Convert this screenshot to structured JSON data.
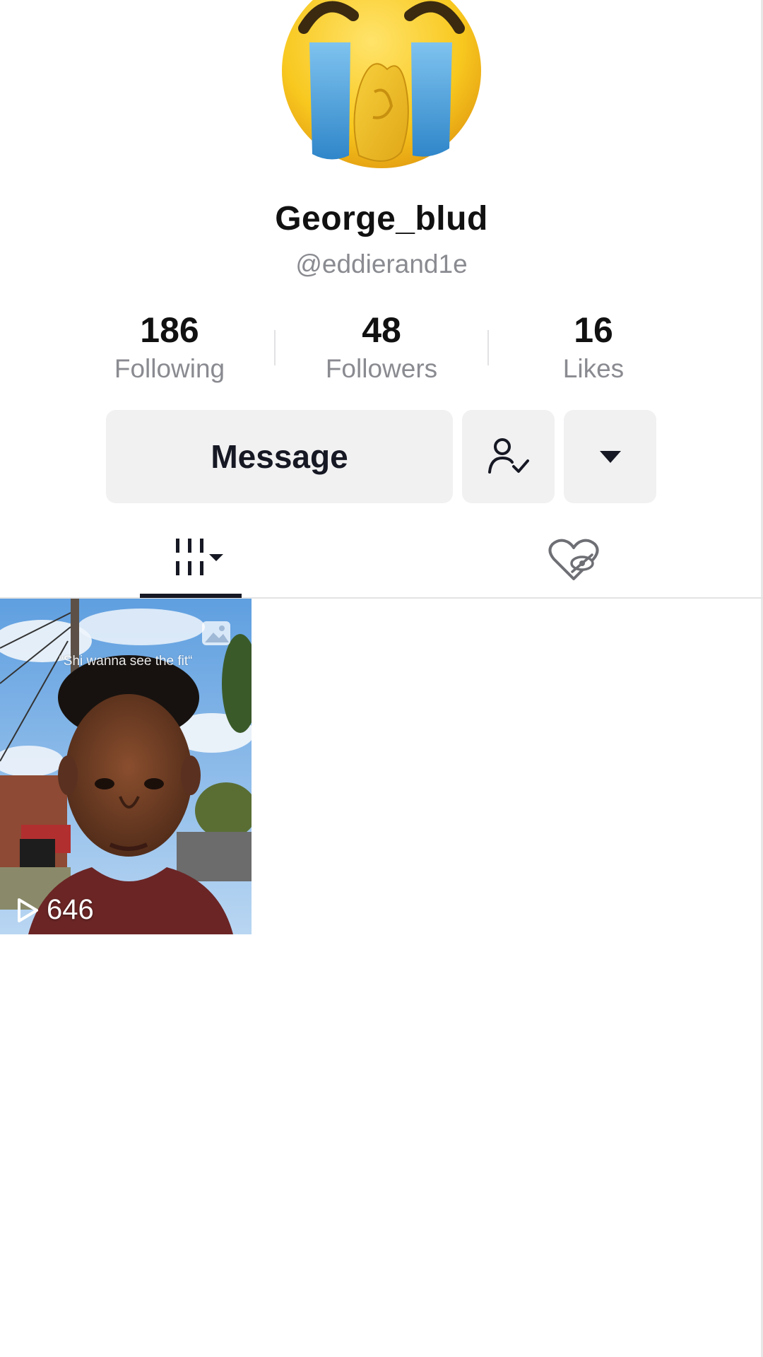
{
  "profile": {
    "display_name": "George_blud",
    "handle": "@eddierand1e",
    "avatar": "loudly-crying-face-emoji"
  },
  "stats": {
    "following_count": "186",
    "following_label": "Following",
    "followers_count": "48",
    "followers_label": "Followers",
    "likes_count": "16",
    "likes_label": "Likes"
  },
  "actions": {
    "message_label": "Message",
    "following_icon": "person-check-icon",
    "more_icon": "caret-down-icon"
  },
  "tabs": [
    {
      "name": "videos",
      "icon": "grid-icon",
      "selected": true
    },
    {
      "name": "liked",
      "icon": "heart-hidden-icon",
      "selected": false
    }
  ],
  "videos": [
    {
      "caption": "“Shi wanna see the fit“",
      "views": "646",
      "type_icon": "photo-icon"
    }
  ],
  "colors": {
    "text_primary": "#161823",
    "text_secondary": "#8a8b91",
    "button_bg": "#f1f1f2"
  }
}
